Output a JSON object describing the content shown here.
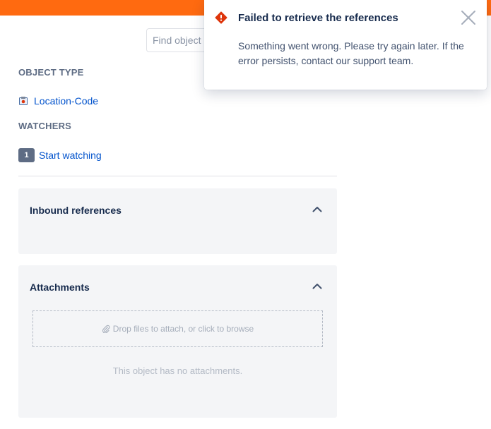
{
  "header": {
    "accent_color": "#ff6a10"
  },
  "search": {
    "placeholder": "Find object"
  },
  "object_type": {
    "heading": "OBJECT TYPE",
    "value": "Location-Code",
    "icon": "object-type-icon"
  },
  "watchers": {
    "heading": "WATCHERS",
    "count": "1",
    "action_label": "Start watching"
  },
  "inbound_references": {
    "title": "Inbound references",
    "expanded": true,
    "icon": "chevron-up-icon"
  },
  "attachments": {
    "title": "Attachments",
    "expanded": true,
    "dropzone_label": "Drop files to attach, or click to browse",
    "dropzone_icon": "paperclip-icon",
    "empty_text": "This object has no attachments."
  },
  "error_flag": {
    "title": "Failed to retrieve the references",
    "message": "Something went wrong. Please try again later. If the error persists, contact our support team.",
    "icon": "error-icon",
    "icon_color": "#de350b",
    "close_icon": "close-icon"
  }
}
